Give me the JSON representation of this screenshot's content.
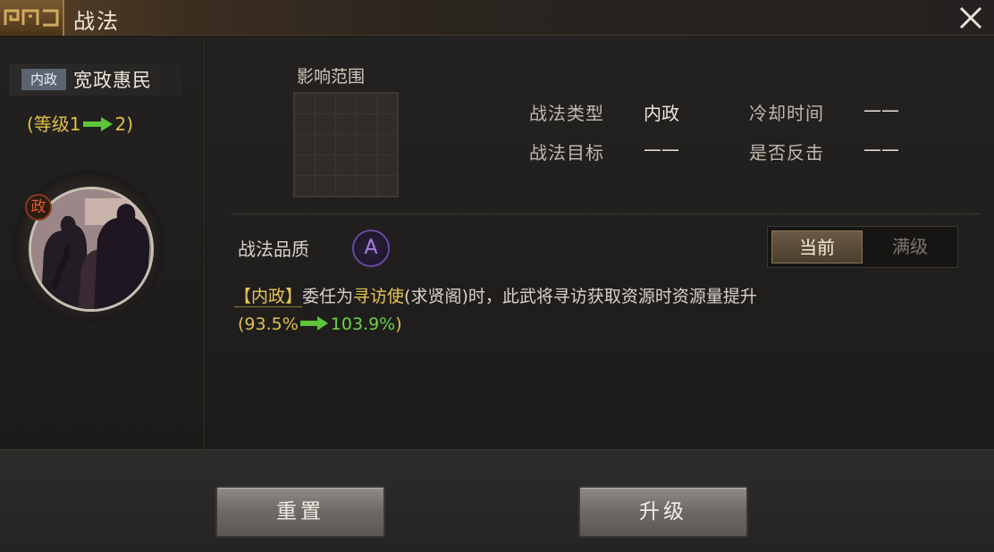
{
  "window": {
    "title": "战法"
  },
  "skill": {
    "category_tag": "内政",
    "name": "宽政惠民",
    "level_prefix": "(等级1",
    "level_suffix": "2)",
    "portrait_badge": "政"
  },
  "details": {
    "range_label": "影响范围",
    "type_label": "战法类型",
    "type_value": "内政",
    "cooldown_label": "冷却时间",
    "cooldown_value": "——",
    "target_label": "战法目标",
    "target_value": "——",
    "counter_label": "是否反击",
    "counter_value": "——",
    "quality_label": "战法品质",
    "quality_value": "A"
  },
  "toggle": {
    "current_label": "当前",
    "max_label": "满级"
  },
  "description": {
    "tag": "【内政】",
    "text_before": "委任为",
    "highlight": "寻访使",
    "text_after": "(求贤阁)时，此武将寻访获取资源时资源量提升",
    "value_open": "(93.5%",
    "value_new": "103.9%",
    "value_close": ")"
  },
  "buttons": {
    "reset_label": "重置",
    "upgrade_label": "升级"
  },
  "colors": {
    "gold": "#e0c04a",
    "green": "#6ad24a",
    "purple": "#6a46a0",
    "accent": "#8a3a1e"
  }
}
